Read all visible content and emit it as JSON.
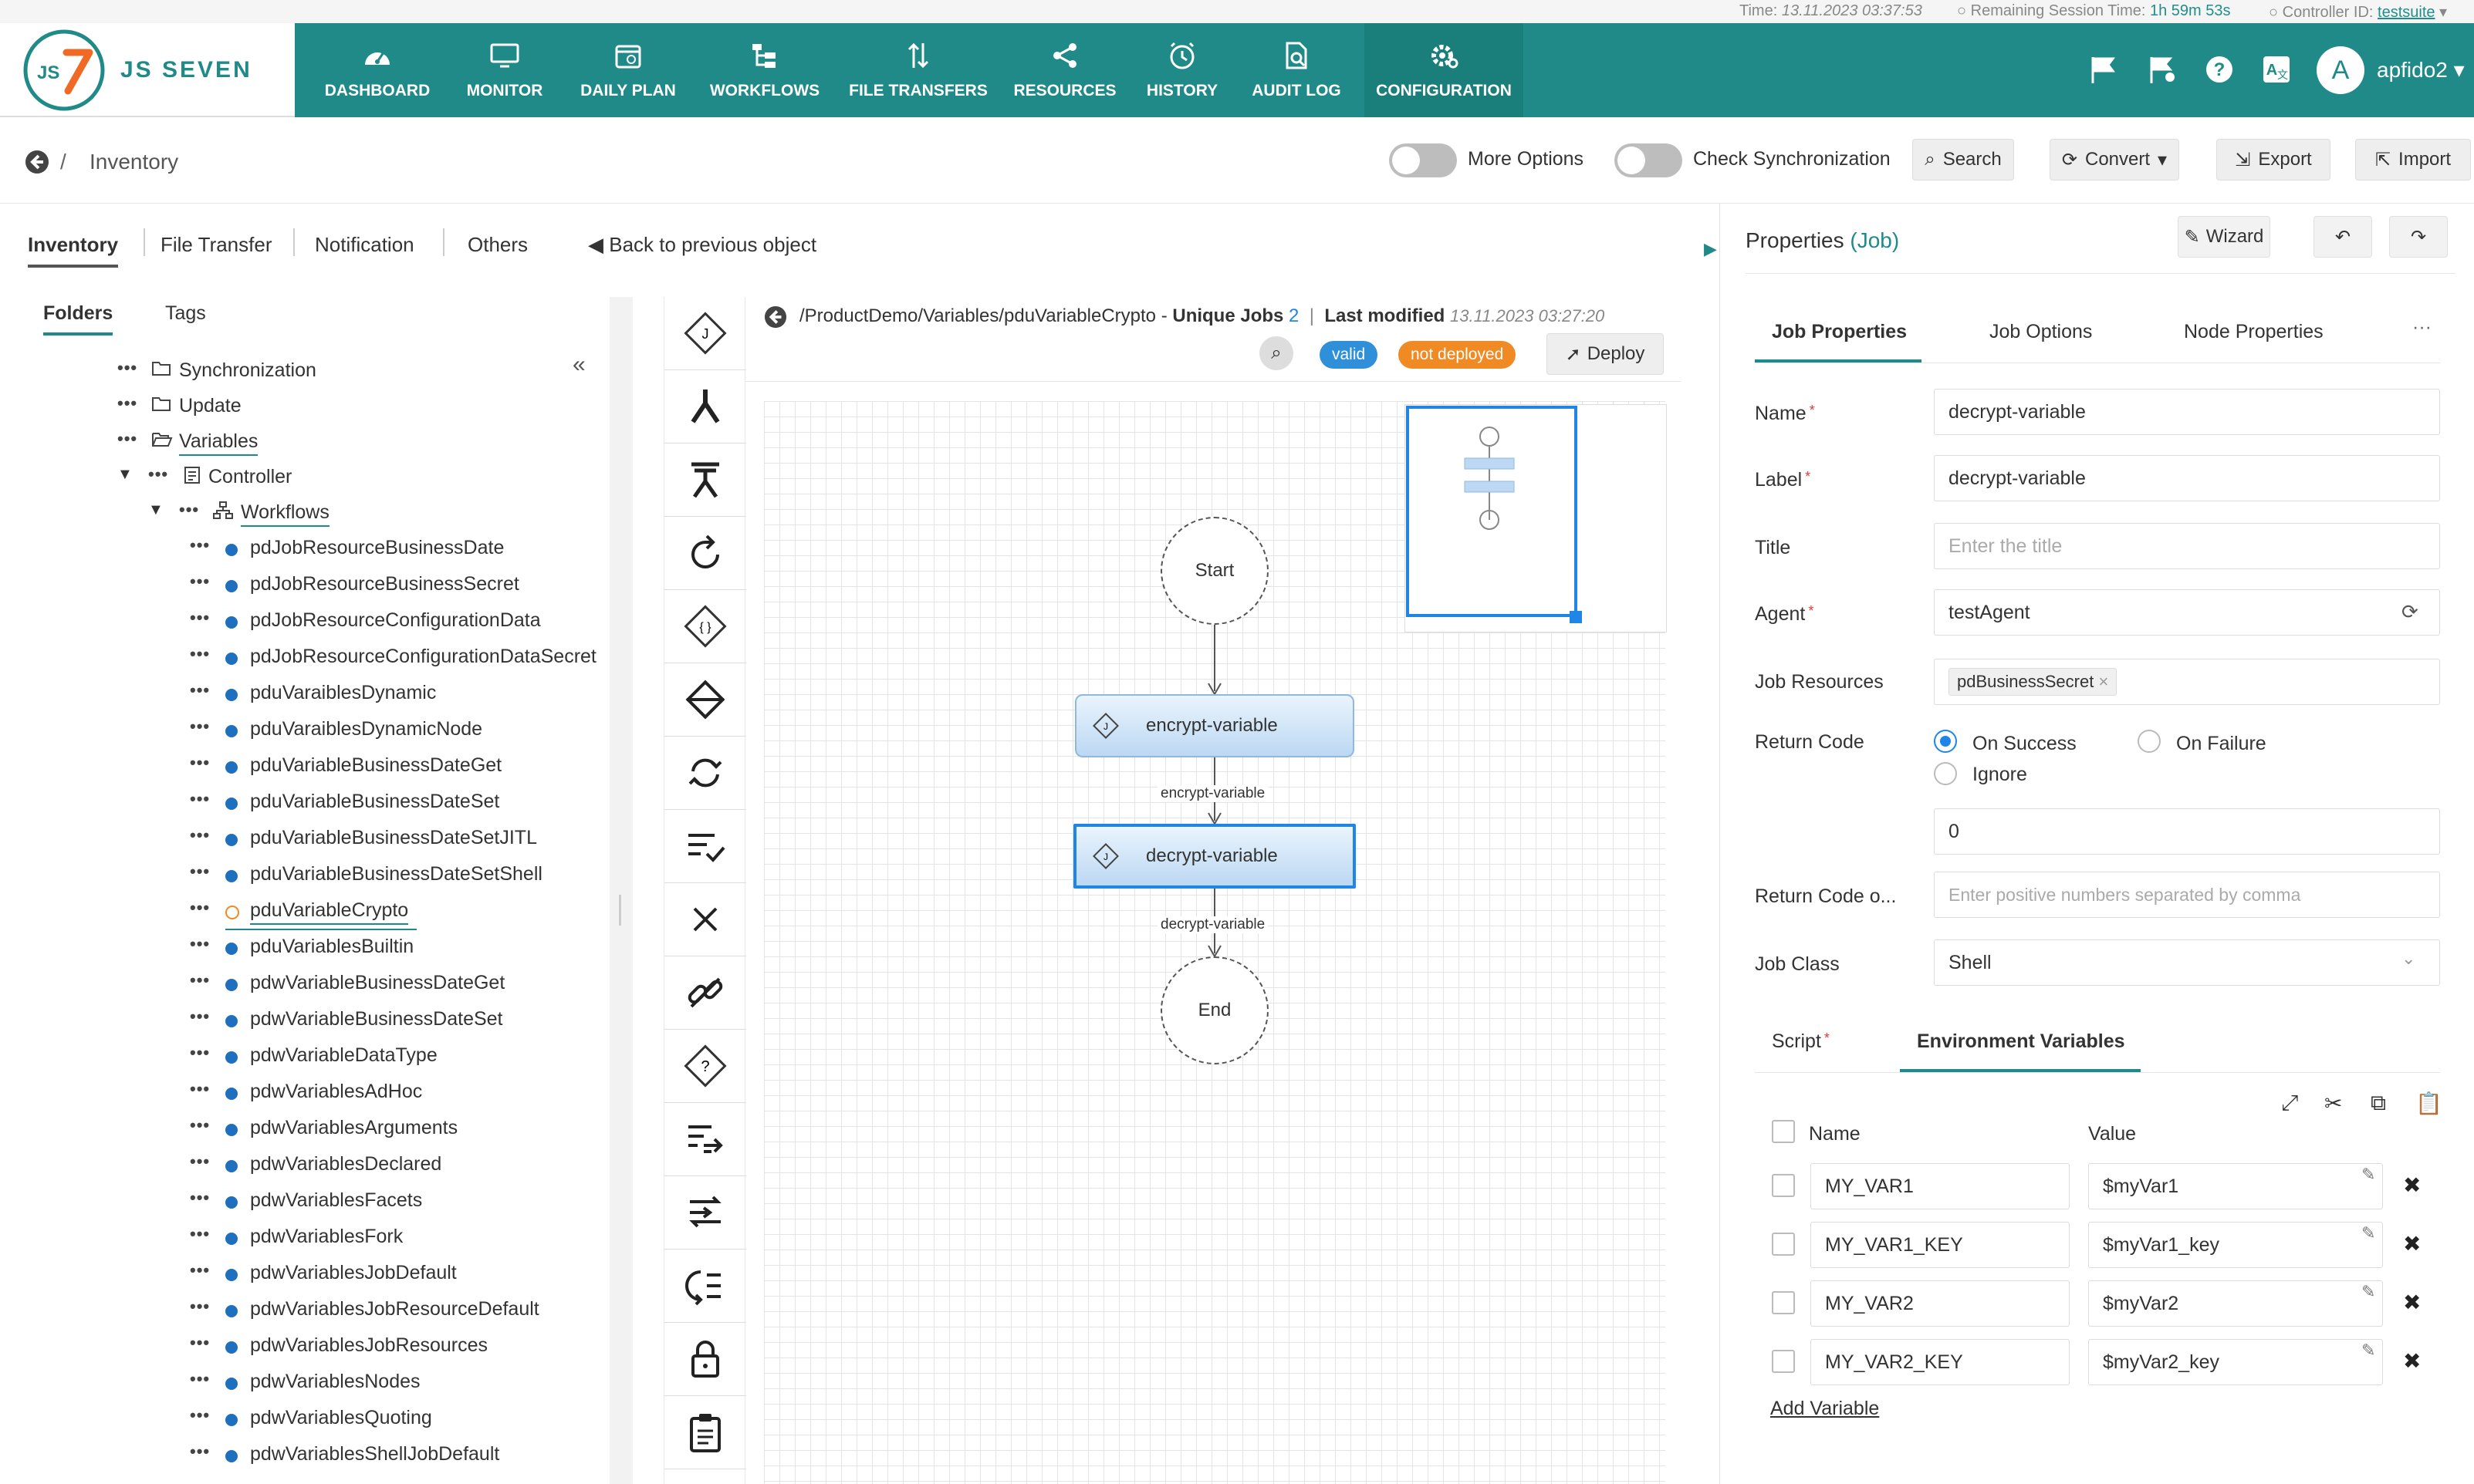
{
  "status": {
    "time_label": "Time:",
    "time_value": "13.11.2023 03:37:53",
    "session_label": "Remaining Session Time:",
    "session_value": "1h 59m 53s",
    "controller_label": "Controller ID:",
    "controller_value": "testsuite"
  },
  "brand": {
    "logo_text": "JS7",
    "name": "JS SEVEN"
  },
  "nav": [
    {
      "label": "DASHBOARD",
      "icon": "dashboard-icon"
    },
    {
      "label": "MONITOR",
      "icon": "monitor-icon"
    },
    {
      "label": "DAILY PLAN",
      "icon": "calendar-icon"
    },
    {
      "label": "WORKFLOWS",
      "icon": "workflow-icon"
    },
    {
      "label": "FILE TRANSFERS",
      "icon": "transfer-icon"
    },
    {
      "label": "RESOURCES",
      "icon": "share-icon"
    },
    {
      "label": "HISTORY",
      "icon": "clock-icon"
    },
    {
      "label": "AUDIT LOG",
      "icon": "audit-icon"
    },
    {
      "label": "CONFIGURATION",
      "icon": "gear-icon"
    }
  ],
  "user": {
    "avatar": "A",
    "name": "apfido2"
  },
  "breadcrumb": {
    "sep": "/",
    "title": "Inventory"
  },
  "toolbar": {
    "more_options": "More Options",
    "check_sync": "Check Synchronization",
    "search": "Search",
    "convert": "Convert",
    "export": "Export",
    "import": "Import"
  },
  "left_tabs": [
    "Inventory",
    "File Transfer",
    "Notification",
    "Others"
  ],
  "back_link": "Back to previous object",
  "subtabs": [
    "Folders",
    "Tags"
  ],
  "tree": {
    "folders": [
      {
        "label": "Synchronization"
      },
      {
        "label": "Update"
      },
      {
        "label": "Variables"
      },
      {
        "label": "Controller"
      },
      {
        "label": "Workflows"
      }
    ],
    "workflows": [
      "pdJobResourceBusinessDate",
      "pdJobResourceBusinessSecret",
      "pdJobResourceConfigurationData",
      "pdJobResourceConfigurationDataSecret",
      "pduVaraiblesDynamic",
      "pduVaraiblesDynamicNode",
      "pduVariableBusinessDateGet",
      "pduVariableBusinessDateSet",
      "pduVariableBusinessDateSetJITL",
      "pduVariableBusinessDateSetShell",
      "pduVariableCrypto",
      "pduVariablesBuiltin",
      "pdwVariableBusinessDateGet",
      "pdwVariableBusinessDateSet",
      "pdwVariableDataType",
      "pdwVariablesAdHoc",
      "pdwVariablesArguments",
      "pdwVariablesDeclared",
      "pdwVariablesFacets",
      "pdwVariablesFork",
      "pdwVariablesJobDefault",
      "pdwVariablesJobResourceDefault",
      "pdwVariablesJobResources",
      "pdwVariablesNodes",
      "pdwVariablesQuoting",
      "pdwVariablesShellJobDefault"
    ]
  },
  "editor": {
    "path": "/ProductDemo/Variables/pduVariableCrypto",
    "dash": "-",
    "unique_label": "Unique Jobs",
    "unique_count": "2",
    "last_modified_label": "Last modified",
    "last_modified_value": "13.11.2023 03:27:20",
    "valid": "valid",
    "not_deployed": "not deployed",
    "deploy": "Deploy"
  },
  "workflow": {
    "start": "Start",
    "job1": "encrypt-variable",
    "edge1": "encrypt-variable",
    "job2": "decrypt-variable",
    "edge2": "decrypt-variable",
    "end": "End"
  },
  "properties": {
    "title": "Properties",
    "type": "(Job)",
    "wizard": "Wizard",
    "tabs": [
      "Job Properties",
      "Job Options",
      "Node Properties"
    ],
    "more": "···",
    "name_label": "Name",
    "name_value": "decrypt-variable",
    "label_label": "Label",
    "label_value": "decrypt-variable",
    "title_label": "Title",
    "title_placeholder": "Enter the title",
    "agent_label": "Agent",
    "agent_value": "testAgent",
    "job_resources_label": "Job Resources",
    "job_resource_tag": "pdBusinessSecret",
    "return_code_label": "Return Code",
    "rc_on_success": "On Success",
    "rc_on_failure": "On Failure",
    "rc_ignore": "Ignore",
    "rc_value": "0",
    "return_code_o_label": "Return Code o...",
    "return_code_o_placeholder": "Enter positive numbers separated by comma",
    "job_class_label": "Job Class",
    "job_class_value": "Shell",
    "subtabs": [
      "Script",
      "Environment Variables"
    ],
    "env_col_name": "Name",
    "env_col_value": "Value",
    "env_vars": [
      {
        "name": "MY_VAR1",
        "value": "$myVar1"
      },
      {
        "name": "MY_VAR1_KEY",
        "value": "$myVar1_key"
      },
      {
        "name": "MY_VAR2",
        "value": "$myVar2"
      },
      {
        "name": "MY_VAR2_KEY",
        "value": "$myVar2_key"
      }
    ],
    "add_variable": "Add Variable"
  },
  "colors": {
    "nav_bg": "#1f8a87",
    "accent": "#1f86e6",
    "valid_badge": "#2f8fd8",
    "not_deployed_badge": "#f08a24",
    "folder_dot": "#1f6fbf"
  }
}
